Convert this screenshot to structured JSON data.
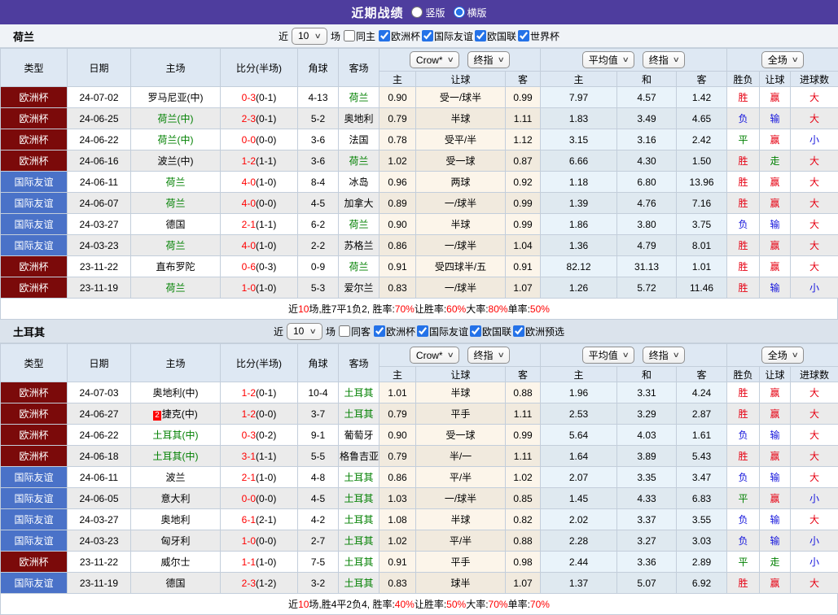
{
  "colors": {
    "topbar_bg": "#4e3d9e",
    "accent_blue": "#2472e8",
    "competition": {
      "欧洲杯": "#7b0a0a",
      "国际友谊": "#4a72c8"
    },
    "team_green": "#008000",
    "score_red": "#ff0000",
    "result_text": {
      "胜": "#e60012",
      "平": "#008000",
      "负": "#1414dc",
      "赢": "#e60012",
      "走": "#008000",
      "输": "#1414dc",
      "大": "#e60012",
      "小": "#1414dc"
    }
  },
  "topbar": {
    "title": "近期战绩",
    "radios": [
      {
        "label": "竖版",
        "selected": false
      },
      {
        "label": "横版",
        "selected": true
      }
    ]
  },
  "table_header": {
    "left_cols": [
      "类型",
      "日期",
      "主场",
      "比分(半场)",
      "角球",
      "客场"
    ],
    "odds_dropdowns": [
      "Crow*",
      "终指"
    ],
    "odds_cols": [
      "主",
      "让球",
      "客"
    ],
    "avg_dropdowns": [
      "平均值",
      "终指"
    ],
    "avg_cols": [
      "主",
      "和",
      "客"
    ],
    "result_dropdown": "全场",
    "result_cols": [
      "胜负",
      "让球",
      "进球数"
    ]
  },
  "sections": [
    {
      "team": "荷兰",
      "header_bg": "#f0f3f7",
      "filter": {
        "near_label": "近",
        "count": "10",
        "games_label": "场",
        "same_label": "同主",
        "same_checked": false,
        "competitions": [
          {
            "label": "欧洲杯",
            "checked": true
          },
          {
            "label": "国际友谊",
            "checked": true
          },
          {
            "label": "欧国联",
            "checked": true
          },
          {
            "label": "世界杯",
            "checked": true
          }
        ]
      },
      "rows": [
        {
          "type": "欧洲杯",
          "date": "24-07-02",
          "home": "罗马尼亚(中)",
          "home_green": false,
          "score": "0-3",
          "half": "(0-1)",
          "corner": "4-13",
          "away": "荷兰",
          "away_green": true,
          "odds_home": "0.90",
          "handicap": "受一/球半",
          "odds_away": "0.99",
          "avg_home": "7.97",
          "avg_draw": "4.57",
          "avg_away": "1.42",
          "result": "胜",
          "handicap_result": "赢",
          "goals": "大"
        },
        {
          "type": "欧洲杯",
          "date": "24-06-25",
          "home": "荷兰(中)",
          "home_green": true,
          "score": "2-3",
          "half": "(0-1)",
          "corner": "5-2",
          "away": "奥地利",
          "away_green": false,
          "odds_home": "0.79",
          "handicap": "半球",
          "odds_away": "1.11",
          "avg_home": "1.83",
          "avg_draw": "3.49",
          "avg_away": "4.65",
          "result": "负",
          "handicap_result": "输",
          "goals": "大"
        },
        {
          "type": "欧洲杯",
          "date": "24-06-22",
          "home": "荷兰(中)",
          "home_green": true,
          "score": "0-0",
          "half": "(0-0)",
          "corner": "3-6",
          "away": "法国",
          "away_green": false,
          "odds_home": "0.78",
          "handicap": "受平/半",
          "odds_away": "1.12",
          "avg_home": "3.15",
          "avg_draw": "3.16",
          "avg_away": "2.42",
          "result": "平",
          "handicap_result": "赢",
          "goals": "小"
        },
        {
          "type": "欧洲杯",
          "date": "24-06-16",
          "home": "波兰(中)",
          "home_green": false,
          "score": "1-2",
          "half": "(1-1)",
          "corner": "3-6",
          "away": "荷兰",
          "away_green": true,
          "odds_home": "1.02",
          "handicap": "受一球",
          "odds_away": "0.87",
          "avg_home": "6.66",
          "avg_draw": "4.30",
          "avg_away": "1.50",
          "result": "胜",
          "handicap_result": "走",
          "goals": "大"
        },
        {
          "type": "国际友谊",
          "date": "24-06-11",
          "home": "荷兰",
          "home_green": true,
          "score": "4-0",
          "half": "(1-0)",
          "corner": "8-4",
          "away": "冰岛",
          "away_green": false,
          "odds_home": "0.96",
          "handicap": "两球",
          "odds_away": "0.92",
          "avg_home": "1.18",
          "avg_draw": "6.80",
          "avg_away": "13.96",
          "result": "胜",
          "handicap_result": "赢",
          "goals": "大"
        },
        {
          "type": "国际友谊",
          "date": "24-06-07",
          "home": "荷兰",
          "home_green": true,
          "score": "4-0",
          "half": "(0-0)",
          "corner": "4-5",
          "away": "加拿大",
          "away_green": false,
          "odds_home": "0.89",
          "handicap": "一/球半",
          "odds_away": "0.99",
          "avg_home": "1.39",
          "avg_draw": "4.76",
          "avg_away": "7.16",
          "result": "胜",
          "handicap_result": "赢",
          "goals": "大"
        },
        {
          "type": "国际友谊",
          "date": "24-03-27",
          "home": "德国",
          "home_green": false,
          "score": "2-1",
          "half": "(1-1)",
          "corner": "6-2",
          "away": "荷兰",
          "away_green": true,
          "odds_home": "0.90",
          "handicap": "半球",
          "odds_away": "0.99",
          "avg_home": "1.86",
          "avg_draw": "3.80",
          "avg_away": "3.75",
          "result": "负",
          "handicap_result": "输",
          "goals": "大"
        },
        {
          "type": "国际友谊",
          "date": "24-03-23",
          "home": "荷兰",
          "home_green": true,
          "score": "4-0",
          "half": "(1-0)",
          "corner": "2-2",
          "away": "苏格兰",
          "away_green": false,
          "odds_home": "0.86",
          "handicap": "一/球半",
          "odds_away": "1.04",
          "avg_home": "1.36",
          "avg_draw": "4.79",
          "avg_away": "8.01",
          "result": "胜",
          "handicap_result": "赢",
          "goals": "大"
        },
        {
          "type": "欧洲杯",
          "date": "23-11-22",
          "home": "直布罗陀",
          "home_green": false,
          "score": "0-6",
          "half": "(0-3)",
          "corner": "0-9",
          "away": "荷兰",
          "away_green": true,
          "odds_home": "0.91",
          "handicap": "受四球半/五",
          "odds_away": "0.91",
          "avg_home": "82.12",
          "avg_draw": "31.13",
          "avg_away": "1.01",
          "result": "胜",
          "handicap_result": "赢",
          "goals": "大"
        },
        {
          "type": "欧洲杯",
          "date": "23-11-19",
          "home": "荷兰",
          "home_green": true,
          "score": "1-0",
          "half": "(1-0)",
          "corner": "5-3",
          "away": "爱尔兰",
          "away_green": false,
          "odds_home": "0.83",
          "handicap": "一/球半",
          "odds_away": "1.07",
          "avg_home": "1.26",
          "avg_draw": "5.72",
          "avg_away": "11.46",
          "result": "胜",
          "handicap_result": "输",
          "goals": "小"
        }
      ],
      "summary_parts": [
        {
          "t": "近",
          "r": 0
        },
        {
          "t": "10",
          "r": 1
        },
        {
          "t": "场,胜7平1负2, 胜率:",
          "r": 0
        },
        {
          "t": "70%",
          "r": 1
        },
        {
          "t": " 让胜率:",
          "r": 0
        },
        {
          "t": "60%",
          "r": 1
        },
        {
          "t": " 大率:",
          "r": 0
        },
        {
          "t": "80%",
          "r": 1
        },
        {
          "t": " 单率:",
          "r": 0
        },
        {
          "t": "50%",
          "r": 1
        }
      ]
    },
    {
      "team": "土耳其",
      "header_bg": "#dbe3ec",
      "filter": {
        "near_label": "近",
        "count": "10",
        "games_label": "场",
        "same_label": "同客",
        "same_checked": false,
        "competitions": [
          {
            "label": "欧洲杯",
            "checked": true
          },
          {
            "label": "国际友谊",
            "checked": true
          },
          {
            "label": "欧国联",
            "checked": true
          },
          {
            "label": "欧洲预选",
            "checked": true
          }
        ]
      },
      "rows": [
        {
          "type": "欧洲杯",
          "date": "24-07-03",
          "home": "奥地利(中)",
          "home_green": false,
          "score": "1-2",
          "half": "(0-1)",
          "corner": "10-4",
          "away": "土耳其",
          "away_green": true,
          "odds_home": "1.01",
          "handicap": "半球",
          "odds_away": "0.88",
          "avg_home": "1.96",
          "avg_draw": "3.31",
          "avg_away": "4.24",
          "result": "胜",
          "handicap_result": "赢",
          "goals": "大"
        },
        {
          "type": "欧洲杯",
          "date": "24-06-27",
          "home": "捷克(中)",
          "home_green": false,
          "home_redcard": "2",
          "score": "1-2",
          "half": "(0-0)",
          "corner": "3-7",
          "away": "土耳其",
          "away_green": true,
          "odds_home": "0.79",
          "handicap": "平手",
          "odds_away": "1.11",
          "avg_home": "2.53",
          "avg_draw": "3.29",
          "avg_away": "2.87",
          "result": "胜",
          "handicap_result": "赢",
          "goals": "大"
        },
        {
          "type": "欧洲杯",
          "date": "24-06-22",
          "home": "土耳其(中)",
          "home_green": true,
          "score": "0-3",
          "half": "(0-2)",
          "corner": "9-1",
          "away": "葡萄牙",
          "away_green": false,
          "odds_home": "0.90",
          "handicap": "受一球",
          "odds_away": "0.99",
          "avg_home": "5.64",
          "avg_draw": "4.03",
          "avg_away": "1.61",
          "result": "负",
          "handicap_result": "输",
          "goals": "大"
        },
        {
          "type": "欧洲杯",
          "date": "24-06-18",
          "home": "土耳其(中)",
          "home_green": true,
          "score": "3-1",
          "half": "(1-1)",
          "corner": "5-5",
          "away": "格鲁吉亚",
          "away_green": false,
          "odds_home": "0.79",
          "handicap": "半/一",
          "odds_away": "1.11",
          "avg_home": "1.64",
          "avg_draw": "3.89",
          "avg_away": "5.43",
          "result": "胜",
          "handicap_result": "赢",
          "goals": "大"
        },
        {
          "type": "国际友谊",
          "date": "24-06-11",
          "home": "波兰",
          "home_green": false,
          "score": "2-1",
          "half": "(1-0)",
          "corner": "4-8",
          "away": "土耳其",
          "away_green": true,
          "odds_home": "0.86",
          "handicap": "平/半",
          "odds_away": "1.02",
          "avg_home": "2.07",
          "avg_draw": "3.35",
          "avg_away": "3.47",
          "result": "负",
          "handicap_result": "输",
          "goals": "大"
        },
        {
          "type": "国际友谊",
          "date": "24-06-05",
          "home": "意大利",
          "home_green": false,
          "score": "0-0",
          "half": "(0-0)",
          "corner": "4-5",
          "away": "土耳其",
          "away_green": true,
          "odds_home": "1.03",
          "handicap": "一/球半",
          "odds_away": "0.85",
          "avg_home": "1.45",
          "avg_draw": "4.33",
          "avg_away": "6.83",
          "result": "平",
          "handicap_result": "赢",
          "goals": "小"
        },
        {
          "type": "国际友谊",
          "date": "24-03-27",
          "home": "奥地利",
          "home_green": false,
          "score": "6-1",
          "half": "(2-1)",
          "corner": "4-2",
          "away": "土耳其",
          "away_green": true,
          "odds_home": "1.08",
          "handicap": "半球",
          "odds_away": "0.82",
          "avg_home": "2.02",
          "avg_draw": "3.37",
          "avg_away": "3.55",
          "result": "负",
          "handicap_result": "输",
          "goals": "大"
        },
        {
          "type": "国际友谊",
          "date": "24-03-23",
          "home": "匈牙利",
          "home_green": false,
          "score": "1-0",
          "half": "(0-0)",
          "corner": "2-7",
          "away": "土耳其",
          "away_green": true,
          "odds_home": "1.02",
          "handicap": "平/半",
          "odds_away": "0.88",
          "avg_home": "2.28",
          "avg_draw": "3.27",
          "avg_away": "3.03",
          "result": "负",
          "handicap_result": "输",
          "goals": "小"
        },
        {
          "type": "欧洲杯",
          "date": "23-11-22",
          "home": "威尔士",
          "home_green": false,
          "score": "1-1",
          "half": "(1-0)",
          "corner": "7-5",
          "away": "土耳其",
          "away_green": true,
          "odds_home": "0.91",
          "handicap": "平手",
          "odds_away": "0.98",
          "avg_home": "2.44",
          "avg_draw": "3.36",
          "avg_away": "2.89",
          "result": "平",
          "handicap_result": "走",
          "goals": "小"
        },
        {
          "type": "国际友谊",
          "date": "23-11-19",
          "home": "德国",
          "home_green": false,
          "score": "2-3",
          "half": "(1-2)",
          "corner": "3-2",
          "away": "土耳其",
          "away_green": true,
          "odds_home": "0.83",
          "handicap": "球半",
          "odds_away": "1.07",
          "avg_home": "1.37",
          "avg_draw": "5.07",
          "avg_away": "6.92",
          "result": "胜",
          "handicap_result": "赢",
          "goals": "大"
        }
      ],
      "summary_parts": [
        {
          "t": "近",
          "r": 0
        },
        {
          "t": "10",
          "r": 1
        },
        {
          "t": "场,胜4平2负4, 胜率:",
          "r": 0
        },
        {
          "t": "40%",
          "r": 1
        },
        {
          "t": " 让胜率:",
          "r": 0
        },
        {
          "t": "50%",
          "r": 1
        },
        {
          "t": " 大率:",
          "r": 0
        },
        {
          "t": "70%",
          "r": 1
        },
        {
          "t": " 单率:",
          "r": 0
        },
        {
          "t": "70%",
          "r": 1
        }
      ]
    }
  ]
}
